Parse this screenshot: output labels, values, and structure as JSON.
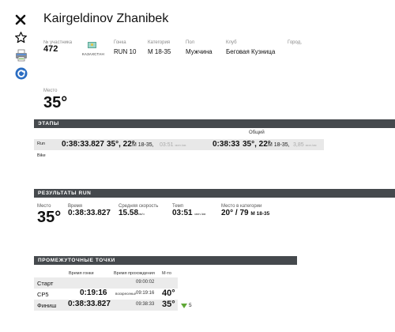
{
  "athlete": {
    "name": "Kairgeldinov Zhanibek"
  },
  "info": {
    "bib_label": "№ участника",
    "bib": "472",
    "country": "КАЗАХСТАН",
    "race_label": "Гонка",
    "race": "RUN 10",
    "category_label": "Категория",
    "category": "M 18-35",
    "gender_label": "Пол",
    "gender": "Мужчина",
    "club_label": "Клуб",
    "club": "Беговая Кузница",
    "city_label": "Город,"
  },
  "place": {
    "label": "Место",
    "value": "35°"
  },
  "sections": {
    "stages": "ЭТАПЫ",
    "results": "РЕЗУЛЬТАТЫ RUN",
    "splits": "ПРОМЕЖУТОЧНЫЕ ТОЧКИ"
  },
  "stages": {
    "overall_label": "Общий",
    "run": {
      "name": "Run",
      "time": "0:38:33.827",
      "place": "35°, 22°",
      "category": "M 18-35,",
      "pace": "03:51",
      "pace_unit": "мин./км",
      "overall_time": "0:38:33",
      "overall_place": "35°, 22°",
      "overall_category": "M 18-35,",
      "overall_pace": "3,85",
      "overall_pace_unit": "мин./км"
    },
    "bike": {
      "name": "Bike"
    }
  },
  "results": {
    "place_label": "Место",
    "place": "35°",
    "time_label": "Время",
    "time": "0:38:33.827",
    "speed_label": "Средняя скорость",
    "speed": "15.58",
    "speed_unit": "км/ч",
    "pace_label": "Темп",
    "pace": "03:51",
    "pace_unit": "мин./км",
    "catplace_label": "Место в категории",
    "catplace": "20° / 79",
    "catplace_cat": "M 18-35"
  },
  "splits": {
    "headers": {
      "race_time": "Время гонки",
      "tod": "Время прохождения",
      "place": "М-то"
    },
    "rows": [
      {
        "name": "Старт",
        "race_time": "",
        "tod_label": "",
        "tod": "09:00:02",
        "place": ""
      },
      {
        "name": "CP5",
        "race_time": "0:19:16",
        "tod_label": "воскресенье",
        "tod": "09:19:16",
        "place": "40°"
      },
      {
        "name": "Финиш",
        "race_time": "0:38:33.827",
        "tod_label": "",
        "tod": "09:38:33",
        "place": "35°",
        "gain": "5"
      }
    ]
  },
  "colors": {
    "bar": "#45494d",
    "gain": "#5fa836",
    "refresh": "#2b6dc2"
  }
}
